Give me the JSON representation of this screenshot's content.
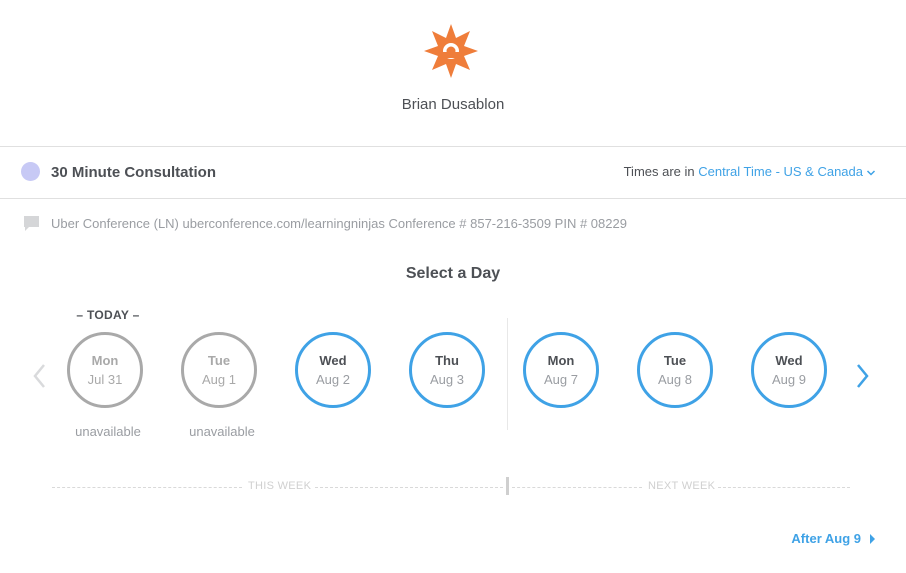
{
  "host": {
    "name": "Brian Dusablon",
    "logo_icon": "sun-logo",
    "logo_color": "#ef7d3a"
  },
  "event": {
    "title": "30 Minute Consultation",
    "dot_color": "#c7c9f5"
  },
  "timezone": {
    "prefix": "Times are in",
    "value": "Central Time - US & Canada"
  },
  "location": {
    "icon": "chat-bubble-icon",
    "text": "Uber Conference (LN) uberconference.com/learningninjas Conference # 857-216-3509 PIN # 08229"
  },
  "calendar": {
    "title": "Select a Day",
    "today_label": "– TODAY –",
    "days": [
      {
        "dow": "Mon",
        "date": "Jul 31",
        "available": false,
        "note": "unavailable"
      },
      {
        "dow": "Tue",
        "date": "Aug 1",
        "available": false,
        "note": "unavailable"
      },
      {
        "dow": "Wed",
        "date": "Aug 2",
        "available": true
      },
      {
        "dow": "Thu",
        "date": "Aug 3",
        "available": true
      },
      {
        "dow": "Mon",
        "date": "Aug 7",
        "available": true
      },
      {
        "dow": "Tue",
        "date": "Aug 8",
        "available": true
      },
      {
        "dow": "Wed",
        "date": "Aug 9",
        "available": true
      }
    ],
    "this_week_label": "THIS WEEK",
    "next_week_label": "NEXT WEEK",
    "after_label": "After Aug 9"
  },
  "colors": {
    "accent": "#3fa2e6",
    "unavailable": "#a9a9a9",
    "text": "#4d5055",
    "muted": "#9a9da2"
  }
}
